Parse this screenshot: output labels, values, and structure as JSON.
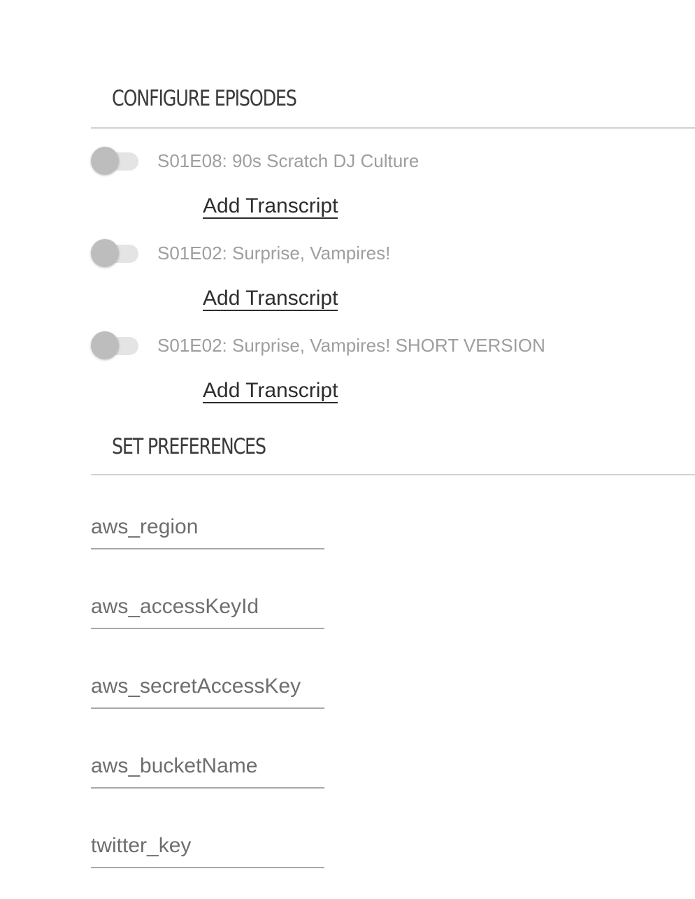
{
  "sections": {
    "episodes_title": "CONFIGURE EPISODES",
    "preferences_title": "SET PREFERENCES"
  },
  "episodes": [
    {
      "title": "S01E08: 90s Scratch DJ Culture",
      "enabled": false,
      "action_label": "Add Transcript"
    },
    {
      "title": "S01E02: Surprise, Vampires!",
      "enabled": false,
      "action_label": "Add Transcript"
    },
    {
      "title": "S01E02: Surprise, Vampires! SHORT VERSION",
      "enabled": false,
      "action_label": "Add Transcript"
    }
  ],
  "preferences": [
    {
      "placeholder": "aws_region",
      "value": ""
    },
    {
      "placeholder": "aws_accessKeyId",
      "value": ""
    },
    {
      "placeholder": "aws_secretAccessKey",
      "value": ""
    },
    {
      "placeholder": "aws_bucketName",
      "value": ""
    },
    {
      "placeholder": "twitter_key",
      "value": ""
    }
  ],
  "colors": {
    "heading": "#3a3a3a",
    "divider": "#d2d2d2",
    "episode_text": "#9e9e9e",
    "toggle_knob_off": "#bdbdbd",
    "toggle_track_off": "#e4e4e4",
    "link": "#2d2d2d",
    "input_text": "#6e6e6e",
    "input_underline": "#a8a8a8"
  }
}
